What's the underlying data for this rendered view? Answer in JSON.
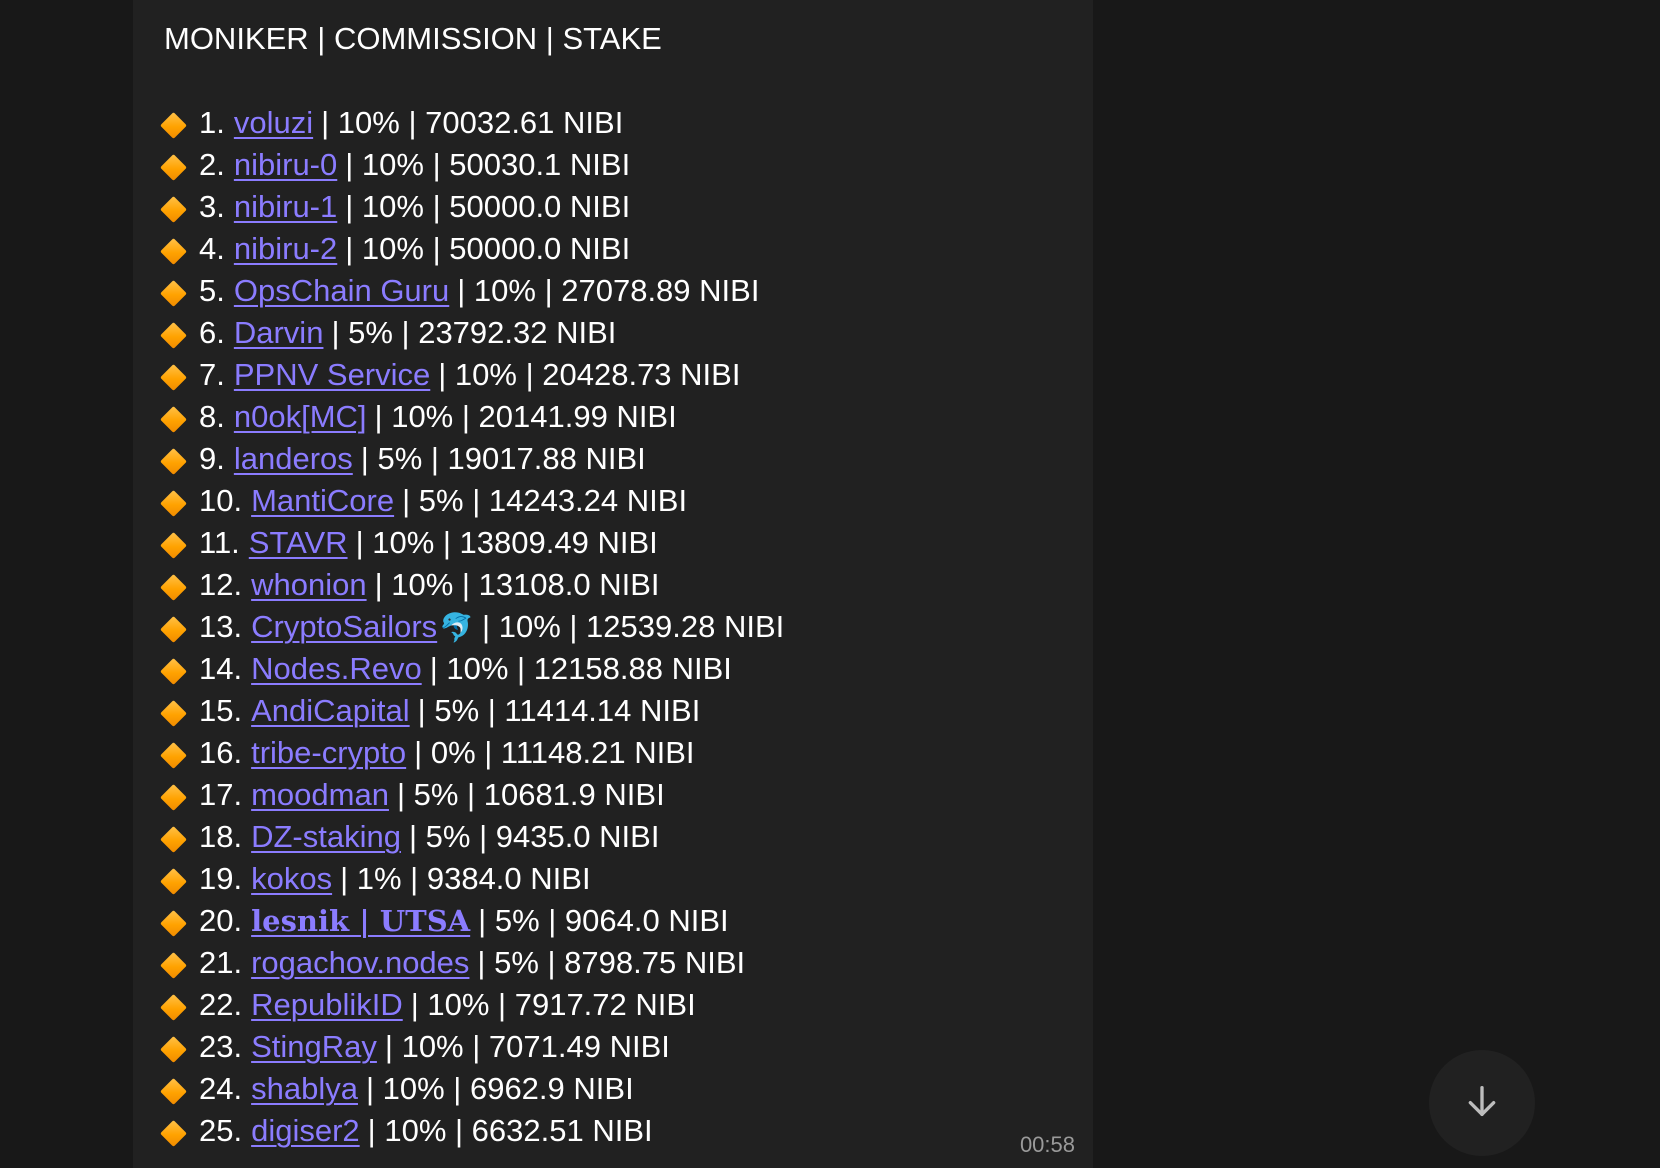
{
  "message": {
    "header": "MONIKER | COMMISSION | STAKE",
    "time": "00:58",
    "validators": [
      {
        "rank": "1.",
        "moniker": "voluzi",
        "rest": "| 10% | 70032.61 NIBI"
      },
      {
        "rank": "2.",
        "moniker": "nibiru-0",
        "rest": "| 10% | 50030.1 NIBI"
      },
      {
        "rank": "3.",
        "moniker": "nibiru-1",
        "rest": "| 10% | 50000.0 NIBI"
      },
      {
        "rank": "4.",
        "moniker": "nibiru-2",
        "rest": "| 10% | 50000.0 NIBI"
      },
      {
        "rank": "5.",
        "moniker": "OpsChain Guru",
        "rest": "| 10% | 27078.89 NIBI"
      },
      {
        "rank": "6.",
        "moniker": "Darvin",
        "rest": "| 5% | 23792.32 NIBI"
      },
      {
        "rank": "7.",
        "moniker": "PPNV Service",
        "rest": "| 10% | 20428.73 NIBI"
      },
      {
        "rank": "8.",
        "moniker": "n0ok[MC]",
        "rest": "| 10% | 20141.99 NIBI"
      },
      {
        "rank": "9.",
        "moniker": "landeros",
        "rest": "| 5% | 19017.88 NIBI"
      },
      {
        "rank": "10.",
        "moniker": "MantiCore",
        "rest": "| 5% | 14243.24 NIBI"
      },
      {
        "rank": "11.",
        "moniker": "STAVR",
        "rest": "| 10% | 13809.49 NIBI"
      },
      {
        "rank": "12.",
        "moniker": "whonion",
        "rest": "| 10% | 13108.0 NIBI"
      },
      {
        "rank": "13.",
        "moniker": "CryptoSailors",
        "emoji": "🐬",
        "rest": "| 10% | 12539.28 NIBI"
      },
      {
        "rank": "14.",
        "moniker": "Nodes.Revo",
        "rest": "| 10% | 12158.88 NIBI"
      },
      {
        "rank": "15.",
        "moniker": "AndiCapital",
        "rest": "| 5% | 11414.14 NIBI"
      },
      {
        "rank": "16.",
        "moniker": "tribe-crypto",
        "rest": "| 0% | 11148.21 NIBI"
      },
      {
        "rank": "17.",
        "moniker": "moodman",
        "rest": "| 5% | 10681.9 NIBI"
      },
      {
        "rank": "18.",
        "moniker": "DZ-staking",
        "rest": "| 5% | 9435.0 NIBI"
      },
      {
        "rank": "19.",
        "moniker": "kokos",
        "rest": "| 1% | 9384.0 NIBI"
      },
      {
        "rank": "20.",
        "moniker": "lesnik | UTSA",
        "style": "serif-bold",
        "rest": "| 5% | 9064.0 NIBI"
      },
      {
        "rank": "21.",
        "moniker": "rogachov.nodes",
        "rest": "| 5% | 8798.75 NIBI"
      },
      {
        "rank": "22.",
        "moniker": "RepublikID",
        "rest": "| 10% | 7917.72 NIBI"
      },
      {
        "rank": "23.",
        "moniker": "StingRay",
        "rest": "| 10% | 7071.49 NIBI"
      },
      {
        "rank": "24.",
        "moniker": "shablya",
        "rest": "| 10% | 6962.9 NIBI"
      },
      {
        "rank": "25.",
        "moniker": "digiser2",
        "rest": "| 10% | 6632.51 NIBI"
      }
    ]
  },
  "icons": {
    "bullet": "large-orange-diamond-icon",
    "scroll": "arrow-down-icon"
  },
  "colors": {
    "background": "#181818",
    "bubble": "#212121",
    "link": "#8b7cff",
    "text": "#ffffff",
    "bullet": "#ffa200",
    "timestamp": "#9a9a9a"
  }
}
